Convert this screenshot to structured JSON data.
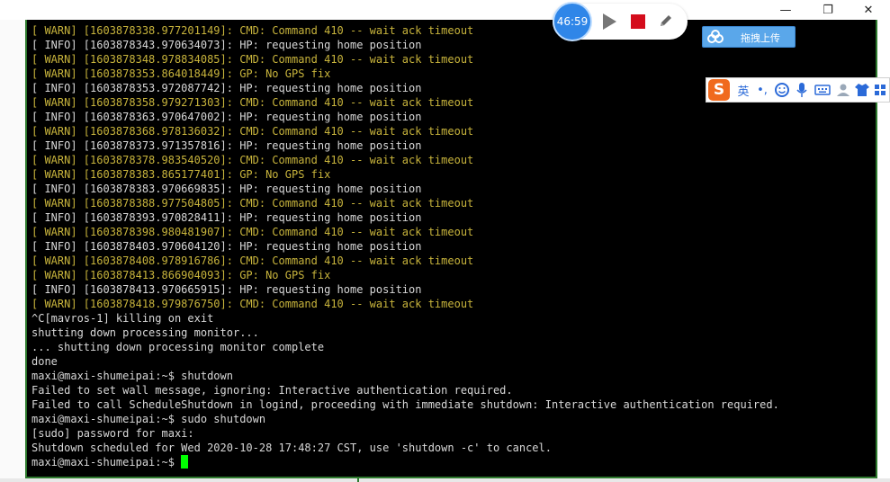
{
  "window": {
    "minimize_glyph": "—",
    "maximize_glyph": "❐",
    "close_glyph": "✕"
  },
  "recorder": {
    "timer": "46:59"
  },
  "upload": {
    "label": "拖拽上传"
  },
  "ime": {
    "logo": "S",
    "lang_label": "英",
    "punct_label": "•,",
    "items": [
      "emoji-icon",
      "microphone-icon",
      "keyboard-icon",
      "user-icon",
      "shirt-icon",
      "grid-icon"
    ]
  },
  "terminal": {
    "lines": [
      {
        "text": "[ WARN] [1603878338.977201149]: CMD: Command 410 -- wait ack timeout",
        "color": "yellow"
      },
      {
        "text": "[ INFO] [1603878343.970634073]: HP: requesting home position",
        "color": "white"
      },
      {
        "text": "[ WARN] [1603878348.978834085]: CMD: Command 410 -- wait ack timeout",
        "color": "yellow"
      },
      {
        "text": "[ WARN] [1603878353.864018449]: GP: No GPS fix",
        "color": "yellow"
      },
      {
        "text": "[ INFO] [1603878353.972087742]: HP: requesting home position",
        "color": "white"
      },
      {
        "text": "[ WARN] [1603878358.979271303]: CMD: Command 410 -- wait ack timeout",
        "color": "yellow"
      },
      {
        "text": "[ INFO] [1603878363.970647002]: HP: requesting home position",
        "color": "white"
      },
      {
        "text": "[ WARN] [1603878368.978136032]: CMD: Command 410 -- wait ack timeout",
        "color": "yellow"
      },
      {
        "text": "[ INFO] [1603878373.971357816]: HP: requesting home position",
        "color": "white"
      },
      {
        "text": "[ WARN] [1603878378.983540520]: CMD: Command 410 -- wait ack timeout",
        "color": "yellow"
      },
      {
        "text": "[ WARN] [1603878383.865177401]: GP: No GPS fix",
        "color": "yellow"
      },
      {
        "text": "[ INFO] [1603878383.970669835]: HP: requesting home position",
        "color": "white"
      },
      {
        "text": "[ WARN] [1603878388.977504805]: CMD: Command 410 -- wait ack timeout",
        "color": "yellow"
      },
      {
        "text": "[ INFO] [1603878393.970828411]: HP: requesting home position",
        "color": "white"
      },
      {
        "text": "[ WARN] [1603878398.980481907]: CMD: Command 410 -- wait ack timeout",
        "color": "yellow"
      },
      {
        "text": "[ INFO] [1603878403.970604120]: HP: requesting home position",
        "color": "white"
      },
      {
        "text": "[ WARN] [1603878408.978916786]: CMD: Command 410 -- wait ack timeout",
        "color": "yellow"
      },
      {
        "text": "[ WARN] [1603878413.866904093]: GP: No GPS fix",
        "color": "yellow"
      },
      {
        "text": "[ INFO] [1603878413.970665915]: HP: requesting home position",
        "color": "white"
      },
      {
        "text": "[ WARN] [1603878418.979876750]: CMD: Command 410 -- wait ack timeout",
        "color": "yellow"
      },
      {
        "text": "^C[mavros-1] killing on exit",
        "color": "white"
      },
      {
        "text": "shutting down processing monitor...",
        "color": "white"
      },
      {
        "text": "... shutting down processing monitor complete",
        "color": "white"
      },
      {
        "text": "done",
        "color": "white"
      },
      {
        "text": "maxi@maxi-shumeipai:~$ shutdown",
        "color": "white"
      },
      {
        "text": "Failed to set wall message, ignoring: Interactive authentication required.",
        "color": "white"
      },
      {
        "text": "Failed to call ScheduleShutdown in logind, proceeding with immediate shutdown: Interactive authentication required.",
        "color": "white"
      },
      {
        "text": "maxi@maxi-shumeipai:~$ sudo shutdown",
        "color": "white"
      },
      {
        "text": "[sudo] password for maxi:",
        "color": "white"
      },
      {
        "text": "Shutdown scheduled for Wed 2020-10-28 17:48:27 CST, use 'shutdown -c' to cancel.",
        "color": "white"
      }
    ],
    "prompt": "maxi@maxi-shumeipai:~$ "
  }
}
